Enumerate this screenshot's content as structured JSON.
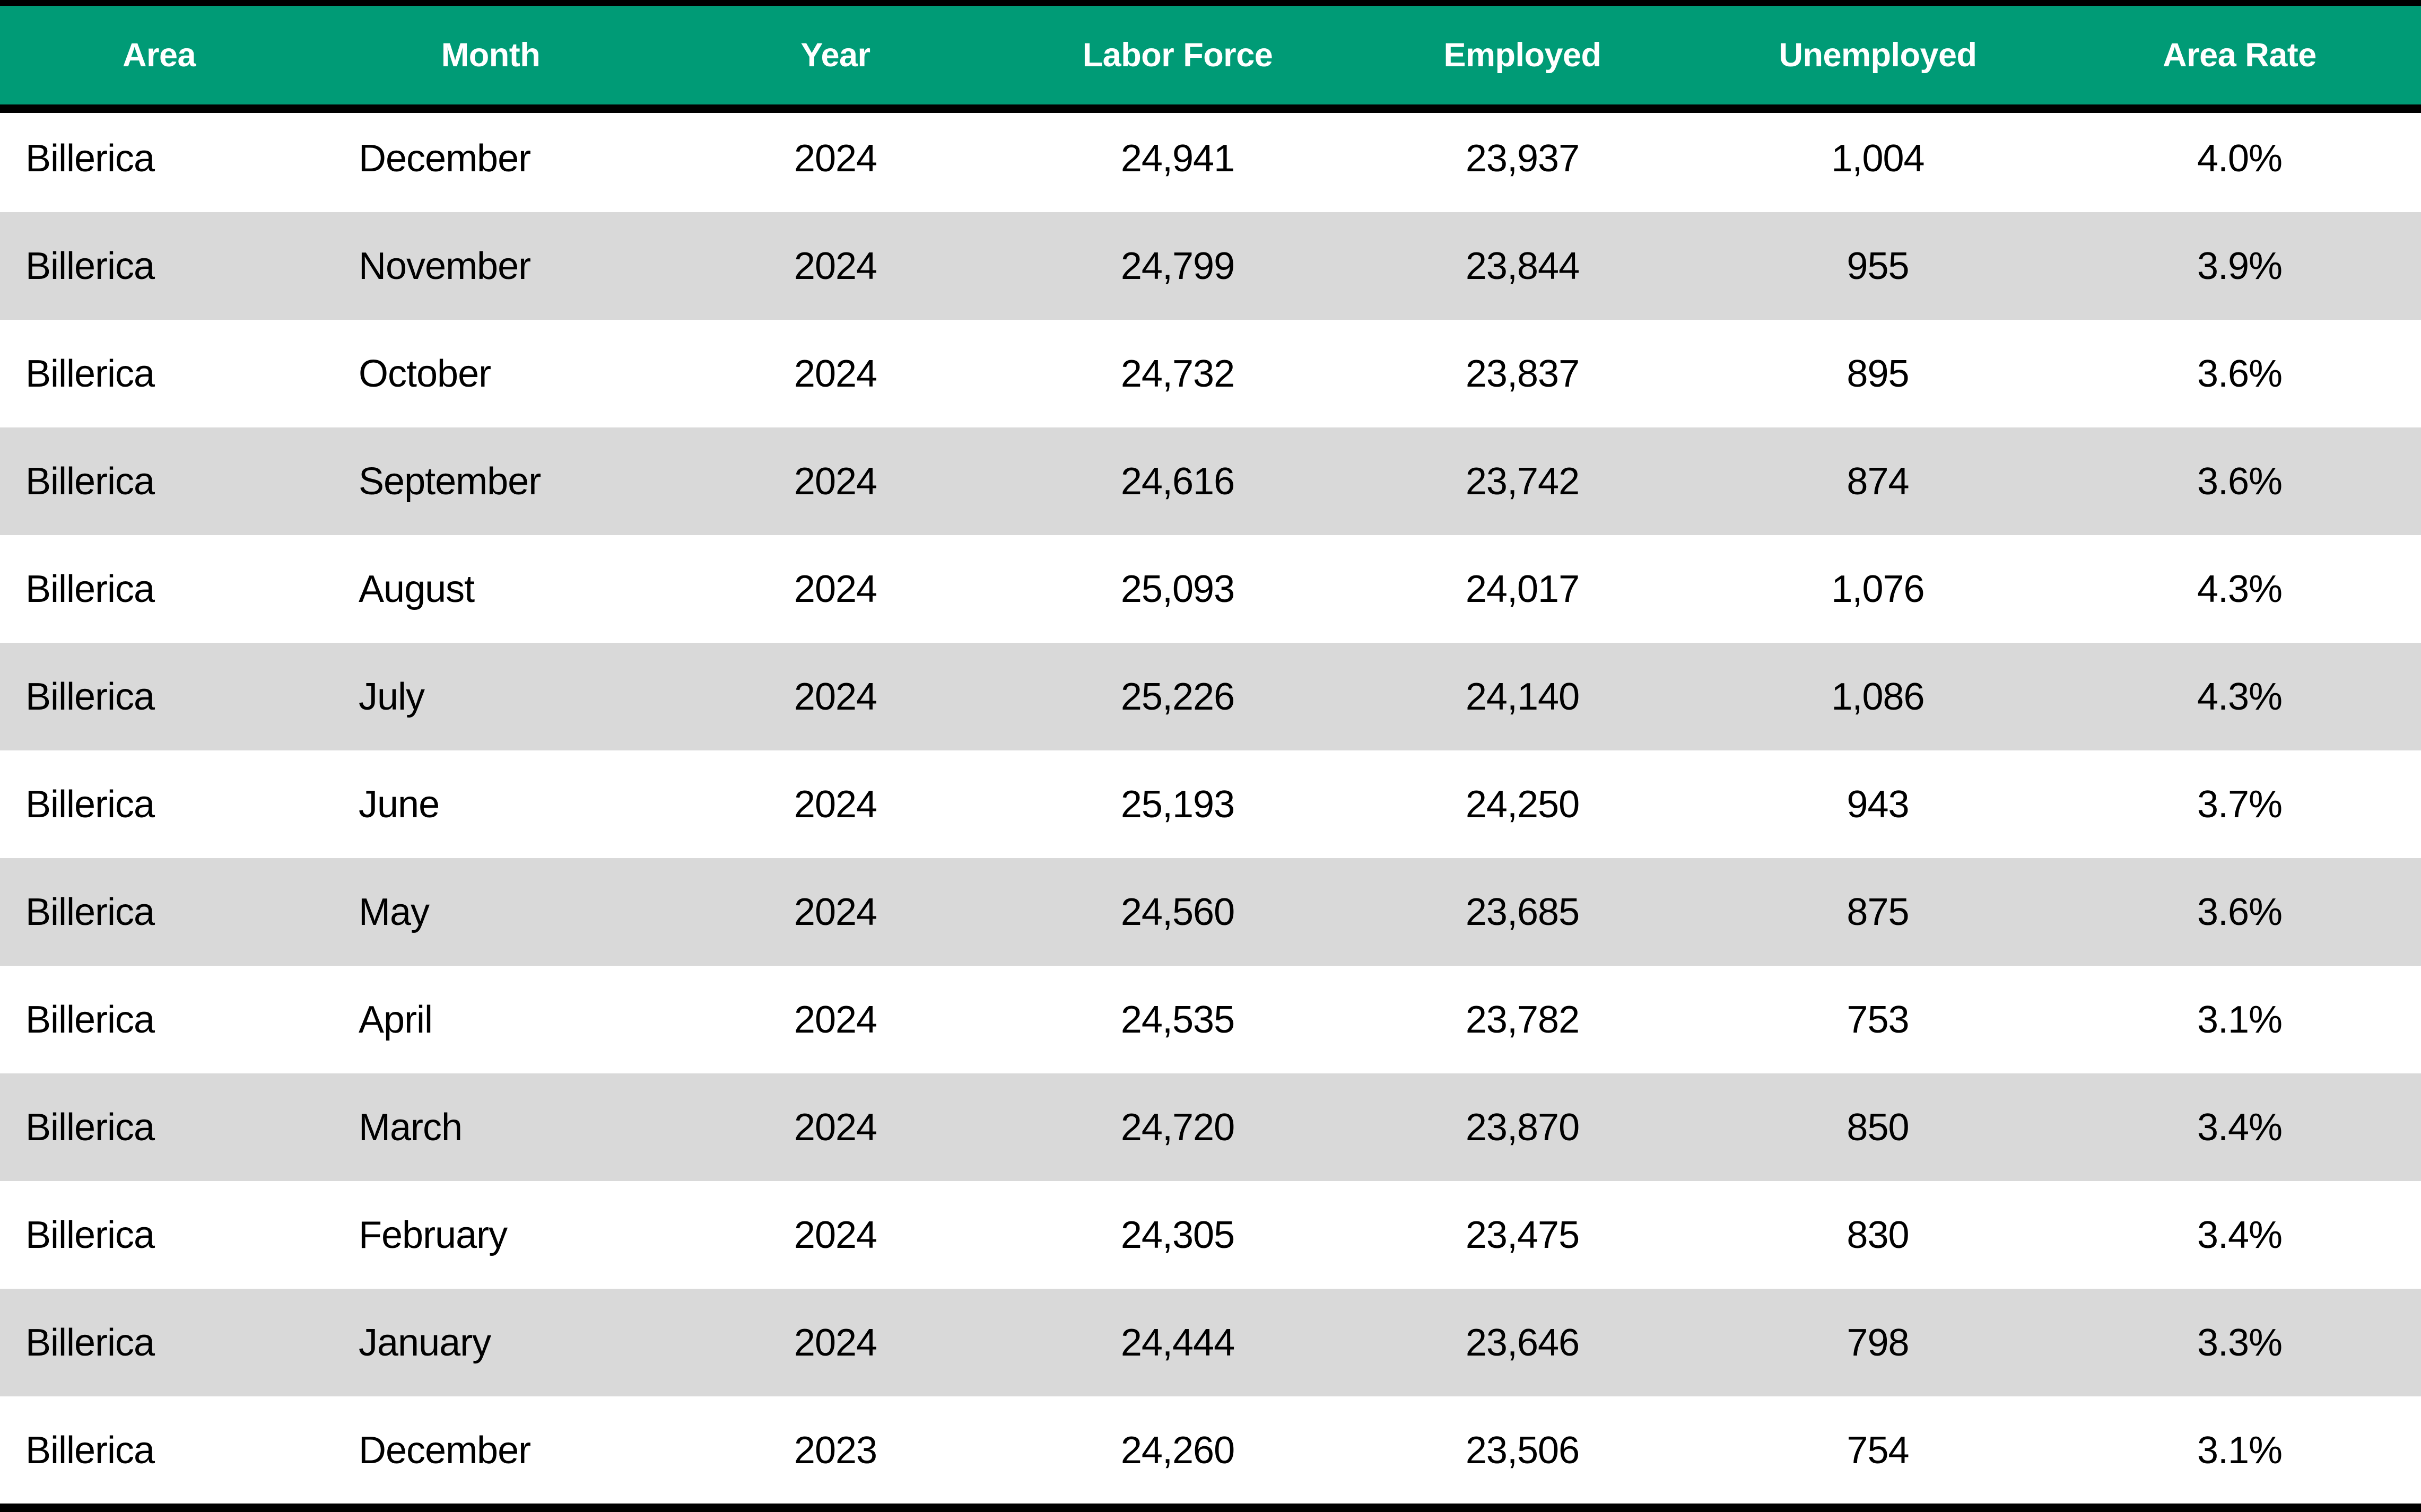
{
  "table": {
    "columns": [
      {
        "key": "area",
        "label": "Area"
      },
      {
        "key": "month",
        "label": "Month"
      },
      {
        "key": "year",
        "label": "Year"
      },
      {
        "key": "labor_force",
        "label": "Labor Force"
      },
      {
        "key": "employed",
        "label": "Employed"
      },
      {
        "key": "unemployed",
        "label": "Unemployed"
      },
      {
        "key": "area_rate",
        "label": "Area Rate"
      }
    ],
    "colors": {
      "header_background": "#009B76",
      "header_text": "#FFFFFF",
      "rule": "#000000",
      "row_even_background": "#FFFFFF",
      "row_odd_background": "#D9D9D9",
      "body_text": "#000000"
    },
    "rows": [
      {
        "area": "Billerica",
        "month": "December",
        "year": "2024",
        "labor_force": "24,941",
        "employed": "23,937",
        "unemployed": "1,004",
        "area_rate": "4.0%"
      },
      {
        "area": "Billerica",
        "month": "November",
        "year": "2024",
        "labor_force": "24,799",
        "employed": "23,844",
        "unemployed": "955",
        "area_rate": "3.9%"
      },
      {
        "area": "Billerica",
        "month": "October",
        "year": "2024",
        "labor_force": "24,732",
        "employed": "23,837",
        "unemployed": "895",
        "area_rate": "3.6%"
      },
      {
        "area": "Billerica",
        "month": "September",
        "year": "2024",
        "labor_force": "24,616",
        "employed": "23,742",
        "unemployed": "874",
        "area_rate": "3.6%"
      },
      {
        "area": "Billerica",
        "month": "August",
        "year": "2024",
        "labor_force": "25,093",
        "employed": "24,017",
        "unemployed": "1,076",
        "area_rate": "4.3%"
      },
      {
        "area": "Billerica",
        "month": "July",
        "year": "2024",
        "labor_force": "25,226",
        "employed": "24,140",
        "unemployed": "1,086",
        "area_rate": "4.3%"
      },
      {
        "area": "Billerica",
        "month": "June",
        "year": "2024",
        "labor_force": "25,193",
        "employed": "24,250",
        "unemployed": "943",
        "area_rate": "3.7%"
      },
      {
        "area": "Billerica",
        "month": "May",
        "year": "2024",
        "labor_force": "24,560",
        "employed": "23,685",
        "unemployed": "875",
        "area_rate": "3.6%"
      },
      {
        "area": "Billerica",
        "month": "April",
        "year": "2024",
        "labor_force": "24,535",
        "employed": "23,782",
        "unemployed": "753",
        "area_rate": "3.1%"
      },
      {
        "area": "Billerica",
        "month": "March",
        "year": "2024",
        "labor_force": "24,720",
        "employed": "23,870",
        "unemployed": "850",
        "area_rate": "3.4%"
      },
      {
        "area": "Billerica",
        "month": "February",
        "year": "2024",
        "labor_force": "24,305",
        "employed": "23,475",
        "unemployed": "830",
        "area_rate": "3.4%"
      },
      {
        "area": "Billerica",
        "month": "January",
        "year": "2024",
        "labor_force": "24,444",
        "employed": "23,646",
        "unemployed": "798",
        "area_rate": "3.3%"
      },
      {
        "area": "Billerica",
        "month": "December",
        "year": "2023",
        "labor_force": "24,260",
        "employed": "23,506",
        "unemployed": "754",
        "area_rate": "3.1%"
      }
    ]
  }
}
